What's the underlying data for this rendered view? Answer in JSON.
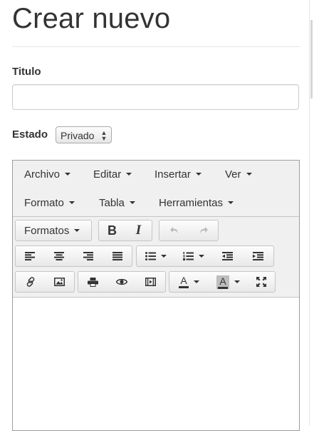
{
  "page": {
    "title": "Crear nuevo"
  },
  "form": {
    "titulo_label": "Titulo",
    "titulo_value": "",
    "estado_label": "Estado",
    "estado_value": "Privado"
  },
  "editor": {
    "menu": [
      "Archivo",
      "Editar",
      "Insertar",
      "Ver",
      "Formato",
      "Tabla",
      "Herramientas"
    ],
    "formats_label": "Formatos",
    "bold_label": "B",
    "italic_label": "I",
    "font_color_label": "A",
    "bg_color_label": "A",
    "content": ""
  },
  "icons": {
    "undo": "undo-icon",
    "redo": "redo-icon",
    "align_left": "align-left-icon",
    "align_center": "align-center-icon",
    "align_right": "align-right-icon",
    "align_justify": "align-justify-icon",
    "bullet_list": "bullet-list-icon",
    "numbered_list": "numbered-list-icon",
    "outdent": "outdent-icon",
    "indent": "indent-icon",
    "link": "link-icon",
    "image": "image-icon",
    "print": "print-icon",
    "preview": "preview-icon",
    "media": "media-icon",
    "fullscreen": "fullscreen-icon"
  },
  "colors": {
    "toolbar_bg": "#f0f0f0",
    "text": "#333333",
    "border": "#c6c6c6"
  }
}
